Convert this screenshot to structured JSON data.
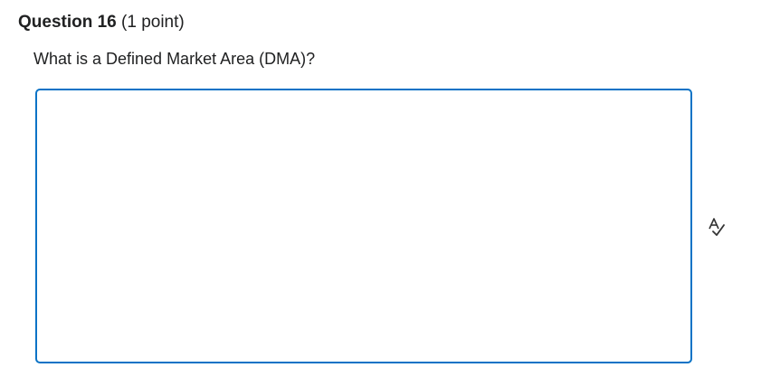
{
  "question": {
    "title": "Question 16",
    "points": "(1 point)",
    "prompt": "What is a Defined Market Area (DMA)?"
  },
  "answer": {
    "value": "",
    "placeholder": ""
  },
  "icons": {
    "spellcheck": "spellcheck-icon"
  },
  "colors": {
    "input_border": "#0a73c6",
    "text": "#202122"
  }
}
